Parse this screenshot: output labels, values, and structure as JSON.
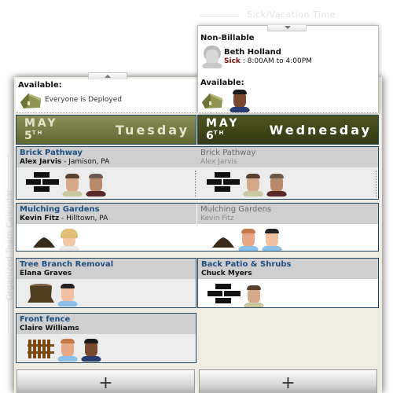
{
  "section_titles": {
    "sick_vacation": "Sick/Vacation Time",
    "side": "Organized Team Calendar"
  },
  "colors": {
    "header_tuesday": "#6f7640",
    "header_wednesday": "#3e4417",
    "card_border": "#22465f",
    "job_title": "#1d4f80",
    "sick_label": "#7a0d0d"
  },
  "days": [
    {
      "month": "MAY",
      "day": "5",
      "suffix": "TH",
      "weekday": "Tuesday",
      "availability": {
        "label": "Available:",
        "message": "Everyone is Deployed",
        "icons": [
          "tent-icon"
        ]
      },
      "toggle": "collapse-up"
    },
    {
      "month": "MAY",
      "day": "6",
      "suffix": "TH",
      "weekday": "Wednesday",
      "non_billable": {
        "label": "Non-Billable",
        "person": "Beth Holland",
        "status": "Sick",
        "separator": " : ",
        "hours": "8:00AM to 4:00PM"
      },
      "availability": {
        "label": "Available:",
        "icons": [
          "tent-icon",
          "worker-avatar"
        ]
      },
      "toggle": "expand-down"
    }
  ],
  "jobs": {
    "tuesday": [
      {
        "title": "Brick Pathway",
        "client": "Alex Jarvis",
        "location": " - Jamison, PA",
        "icon": "brick-icon",
        "crew": 2
      },
      {
        "title": "Mulching Gardens",
        "client": "Kevin Fitz",
        "location": " - Hilltown, PA",
        "icon": "mulch-icon",
        "crew": 1
      },
      {
        "title": "Tree Branch Removal",
        "client": "Elana Graves",
        "location": "",
        "icon": "stump-icon",
        "crew": 1
      },
      {
        "title": "Front fence",
        "client": "Claire Williams",
        "location": "",
        "icon": "fence-icon",
        "crew": 2
      }
    ],
    "wednesday": [
      {
        "title": "Brick Pathway",
        "client": "Alex Jarvis",
        "icon": "brick-icon",
        "crew": 2,
        "continued": true
      },
      {
        "title": "Mulching Gardens",
        "client": "Kevin Fitz",
        "icon": "mulch-icon",
        "crew": 2,
        "continued": true
      },
      {
        "title": "Back Patio & Shrubs",
        "client": "Chuck Myers",
        "icon": "brick-icon",
        "crew": 1
      }
    ]
  },
  "add_button": "+"
}
